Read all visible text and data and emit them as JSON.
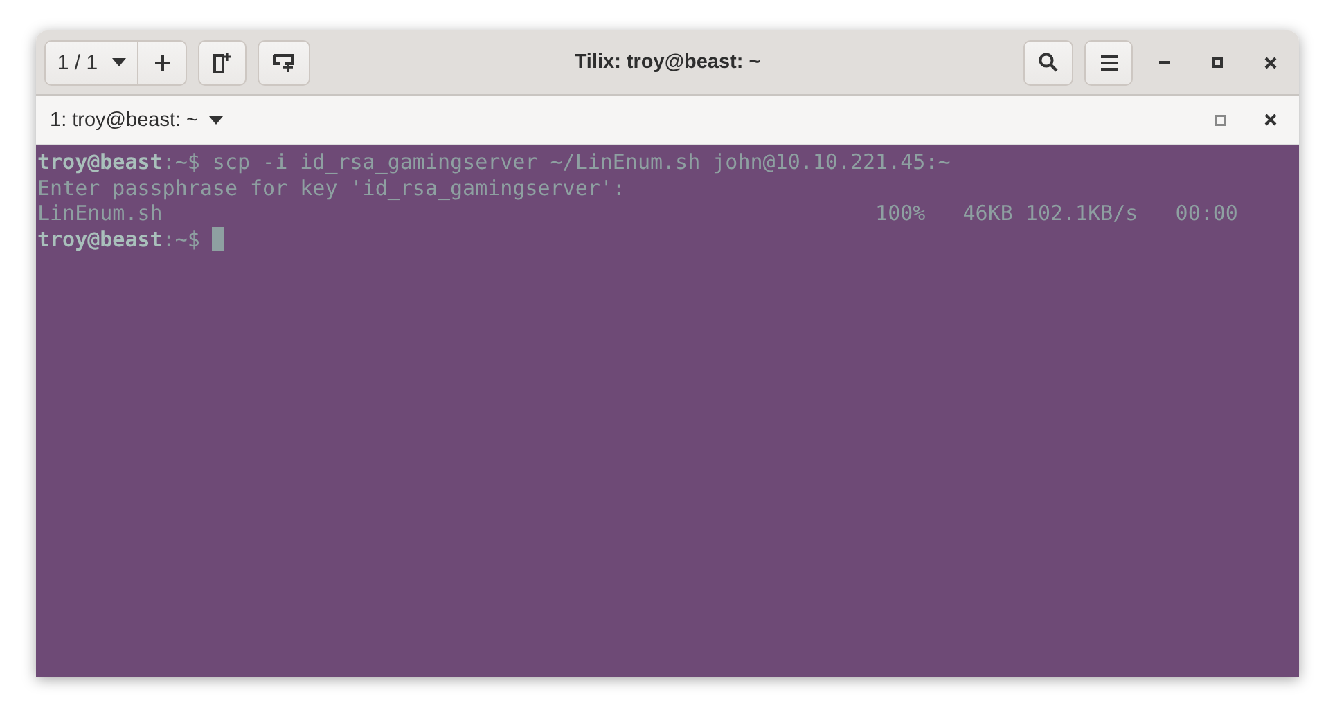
{
  "window": {
    "title": "Tilix: troy@beast: ~"
  },
  "header": {
    "session_counter": "1 / 1"
  },
  "terminal_tab": {
    "title": "1: troy@beast: ~"
  },
  "terminal": {
    "lines": [
      {
        "kind": "prompt",
        "user_host": "troy@beast",
        "path": ":~$",
        "command": "scp -i id_rsa_gamingserver ~/LinEnum.sh john@10.10.221.45:~"
      },
      {
        "kind": "output",
        "text": "Enter passphrase for key 'id_rsa_gamingserver':"
      },
      {
        "kind": "progress",
        "file": "LinEnum.sh",
        "stats": "100%   46KB 102.1KB/s   00:00"
      },
      {
        "kind": "prompt",
        "user_host": "troy@beast",
        "path": ":~$",
        "cursor": true
      }
    ]
  }
}
